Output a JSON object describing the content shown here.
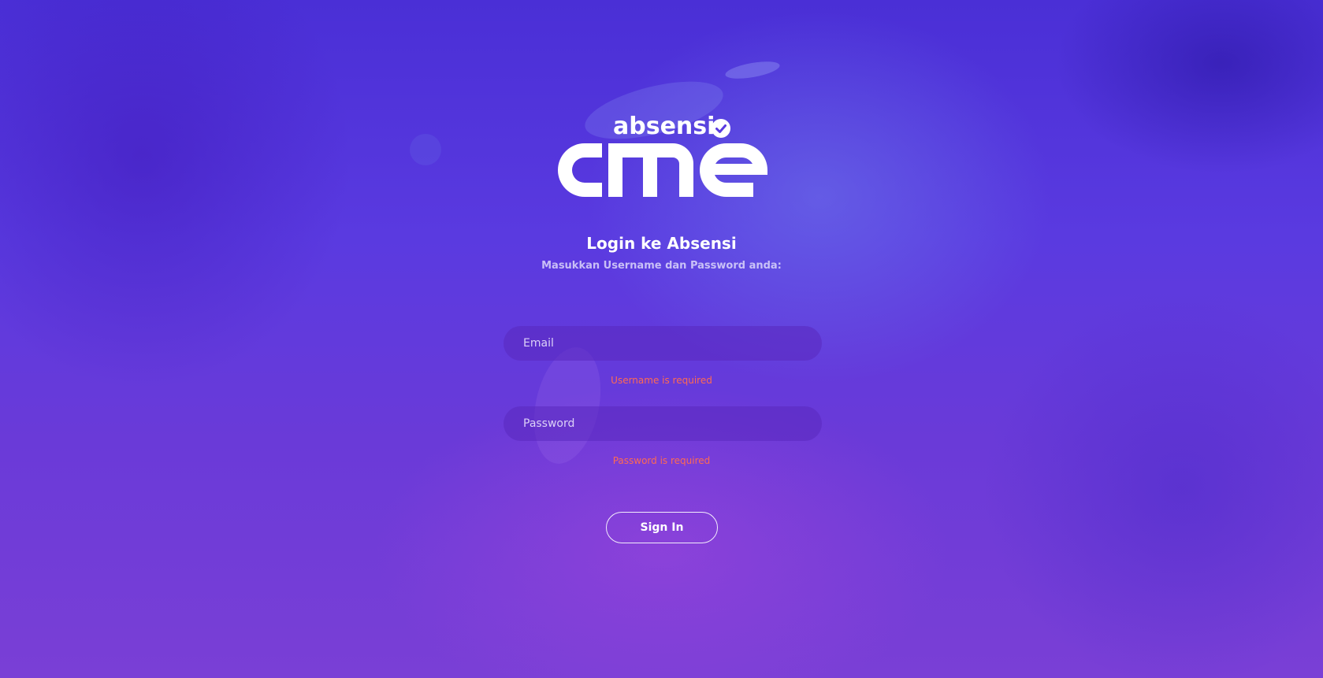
{
  "logo": {
    "top_text": "absensi",
    "main_text": "cme",
    "badge_icon": "check-circle-icon"
  },
  "header": {
    "title": "Login ke Absensi",
    "subtitle": "Masukkan Username dan Password anda:"
  },
  "form": {
    "email_placeholder": "Email",
    "email_value": "",
    "email_error": "Username is required",
    "password_placeholder": "Password",
    "password_value": "",
    "password_error": "Password is required",
    "submit_label": "Sign In"
  },
  "colors": {
    "background_primary": "#4a2fd6",
    "background_secondary": "#7a3fd6",
    "error": "#ff6a52",
    "text": "#ffffff"
  }
}
